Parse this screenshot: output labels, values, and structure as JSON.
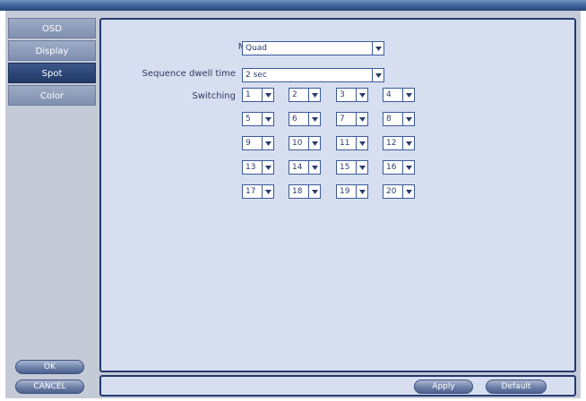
{
  "sidebar": {
    "items": [
      {
        "label": "OSD"
      },
      {
        "label": "Display"
      },
      {
        "label": "Spot"
      },
      {
        "label": "Color"
      }
    ],
    "ok_label": "OK",
    "cancel_label": "CANCEL"
  },
  "form": {
    "mode_label": "Mode",
    "mode_value": "Quad",
    "dwell_label": "Sequence dwell time",
    "dwell_value": "2 sec",
    "switching_label": "Switching",
    "switching": [
      [
        "1",
        "2",
        "3",
        "4"
      ],
      [
        "5",
        "6",
        "7",
        "8"
      ],
      [
        "9",
        "10",
        "11",
        "12"
      ],
      [
        "13",
        "14",
        "15",
        "16"
      ],
      [
        "17",
        "18",
        "19",
        "20"
      ]
    ]
  },
  "footer": {
    "apply_label": "Apply",
    "default_label": "Default"
  },
  "icons": {
    "dropdown": "chevron-down-icon"
  },
  "colors": {
    "active_tab": "#2c4677",
    "panel_border": "#223a70",
    "panel_bg": "#d7def0"
  }
}
